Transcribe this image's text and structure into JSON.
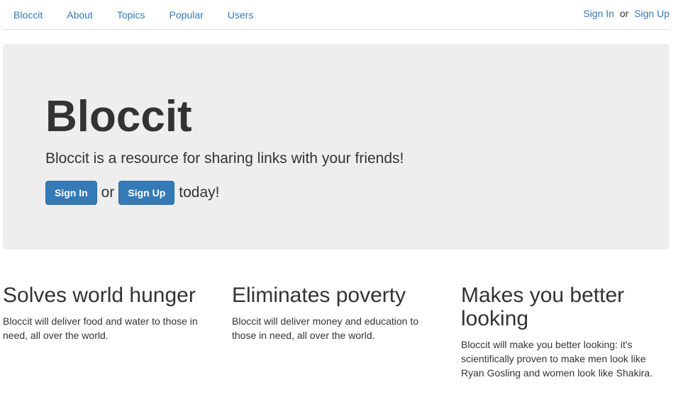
{
  "nav": {
    "brand": "Bloccit",
    "links": [
      "About",
      "Topics",
      "Popular",
      "Users"
    ],
    "sign_in": "Sign In",
    "or": "or",
    "sign_up": "Sign Up"
  },
  "jumbotron": {
    "title": "Bloccit",
    "lead": "Bloccit is a resource for sharing links with your friends!",
    "sign_in_button": "Sign In",
    "or": "or",
    "sign_up_button": "Sign Up",
    "suffix": "today!"
  },
  "features": [
    {
      "title": "Solves world hunger",
      "body": "Bloccit will deliver food and water to those in need, all over the world."
    },
    {
      "title": "Eliminates poverty",
      "body": "Bloccit will deliver money and education to those in need, all over the world."
    },
    {
      "title": "Makes you better looking",
      "body": "Bloccit will make you better looking: it's scientifically proven to make men look like Ryan Gosling and women look like Shakira."
    }
  ]
}
